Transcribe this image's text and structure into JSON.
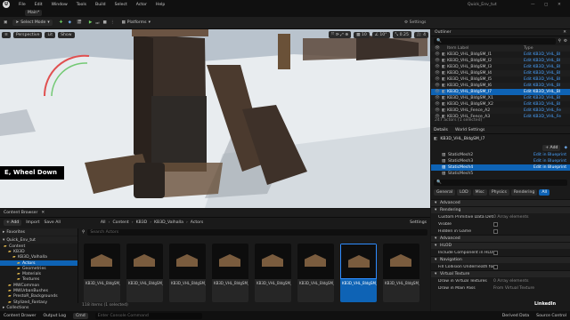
{
  "window": {
    "menu": [
      "File",
      "Edit",
      "Window",
      "Tools",
      "Build",
      "Select",
      "Actor",
      "Help"
    ],
    "project": "Quick_Env_tut",
    "level_tab": "Main*"
  },
  "toolbar": {
    "mode": "Select Mode",
    "platforms": "Platforms"
  },
  "viewport": {
    "view_buttons": [
      "Perspective",
      "Lit",
      "Show"
    ],
    "caption": "E, Wheel Down"
  },
  "outliner": {
    "title": "Outliner",
    "col_label": "Item Label",
    "col_type": "Type",
    "rows": [
      {
        "label": "KB3D_VHL_BldgSM_I1",
        "type": "Edit KB3D_VHL_Bl"
      },
      {
        "label": "KB3D_VHL_BldgSM_I2",
        "type": "Edit KB3D_VHL_Bl"
      },
      {
        "label": "KB3D_VHL_BldgSM_I3",
        "type": "Edit KB3D_VHL_Bl"
      },
      {
        "label": "KB3D_VHL_BldgSM_I4",
        "type": "Edit KB3D_VHL_Bl"
      },
      {
        "label": "KB3D_VHL_BldgSM_I5",
        "type": "Edit KB3D_VHL_Bl"
      },
      {
        "label": "KB3D_VHL_BldgSM_I6",
        "type": "Edit KB3D_VHL_Bl"
      },
      {
        "label": "KB3D_VHL_BldgSM_I7",
        "type": "Edit KB3D_VHL_Bl"
      },
      {
        "label": "KB3D_VHL_BldgSM_X1",
        "type": "Edit KB3D_VHL_Bl"
      },
      {
        "label": "KB3D_VHL_BldgSM_X2",
        "type": "Edit KB3D_VHL_Bl"
      },
      {
        "label": "KB3D_VHL_Fence_A2",
        "type": "Edit KB3D_VHL_Fe"
      },
      {
        "label": "KB3D_VHL_Fence_A3",
        "type": "Edit KB3D_VHL_Fe"
      }
    ],
    "footer": "247 actors (1 selected)"
  },
  "details": {
    "tabs": [
      "Details",
      "World Settings"
    ],
    "actor_name": "KB3D_VHL_BldgSM_I7",
    "add": "+ Add",
    "components": [
      {
        "name": "StaticMesh2",
        "link": "Edit in Blueprint"
      },
      {
        "name": "StaticMesh3",
        "link": "Edit in Blueprint"
      },
      {
        "name": "StaticMesh4",
        "link": "Edit in Blueprint"
      },
      {
        "name": "StaticMesh5",
        "link": ""
      }
    ],
    "filter_tabs": [
      "General",
      "LOD",
      "Misc",
      "Physics",
      "Rendering",
      "All"
    ],
    "sections": [
      {
        "kind": "cat",
        "label": "Advanced"
      },
      {
        "kind": "cat",
        "label": "Rendering"
      },
      {
        "kind": "prop",
        "label": "Custom Primitive Data Defau...",
        "value": "0 Array elements"
      },
      {
        "kind": "prop",
        "label": "Visible",
        "value": ""
      },
      {
        "kind": "prop",
        "label": "Hidden in Game",
        "value": ""
      },
      {
        "kind": "cat",
        "label": "Advanced"
      },
      {
        "kind": "cat",
        "label": "HLOD"
      },
      {
        "kind": "prop",
        "label": "Include Component in HLOD",
        "value": ""
      },
      {
        "kind": "cat",
        "label": "Navigation"
      },
      {
        "kind": "prop",
        "label": "Fill Collision Underneath for",
        "value": ""
      },
      {
        "kind": "cat",
        "label": "Virtual Texture"
      },
      {
        "kind": "prop",
        "label": "Draw in Virtual Textures",
        "value": "0 Array elements"
      },
      {
        "kind": "prop",
        "label": "Draw in Main Pass",
        "value": "From Virtual Texture"
      }
    ]
  },
  "content_browser": {
    "title": "Content Browser",
    "add": "+ Add",
    "import": "Import",
    "save_all": "Save All",
    "settings": "Settings",
    "breadcrumb": [
      "All",
      "Content",
      "KB3D",
      "KB3D_Valhalla",
      "Actors"
    ],
    "favorites": "Favorites",
    "project": "Quick_Env_tut",
    "tree": [
      {
        "label": "Content",
        "depth": 0
      },
      {
        "label": "KB3D",
        "depth": 1
      },
      {
        "label": "KB3D_Valhalla",
        "depth": 2
      },
      {
        "label": "Actors",
        "depth": 3
      },
      {
        "label": "Geometries",
        "depth": 3
      },
      {
        "label": "Materials",
        "depth": 3
      },
      {
        "label": "Textures",
        "depth": 3
      },
      {
        "label": "MWCommon",
        "depth": 1
      },
      {
        "label": "MWUrbanBushes",
        "depth": 1
      },
      {
        "label": "PrestoR_Backgrounds",
        "depth": 1
      },
      {
        "label": "Stylized_Fantasy",
        "depth": 1
      }
    ],
    "search_placeholder": "Search Actors",
    "assets": [
      {
        "label": "KB3D_VHL_BldgSM_..."
      },
      {
        "label": "KB3D_VHL_BldgSM_..."
      },
      {
        "label": "KB3D_VHL_BldgSM_..."
      },
      {
        "label": "KB3D_VHL_BldgSM_..."
      },
      {
        "label": "KB3D_VHL_BldgSM_..."
      },
      {
        "label": "KB3D_VHL_BldgSM_..."
      },
      {
        "label": "KB3D_VHL_BldgSM_..."
      },
      {
        "label": "KB3D_VHL_BldgSM_..."
      }
    ],
    "selected_index": 6,
    "status": "118 items (1 selected)",
    "collections": "Collections"
  },
  "statusbar": {
    "items": [
      "Content Drawer",
      "Output Log",
      "Cmd",
      "Enter Console Command"
    ],
    "right": [
      "Derived Data",
      "Source Control"
    ]
  },
  "watermark": "LinkedIn"
}
